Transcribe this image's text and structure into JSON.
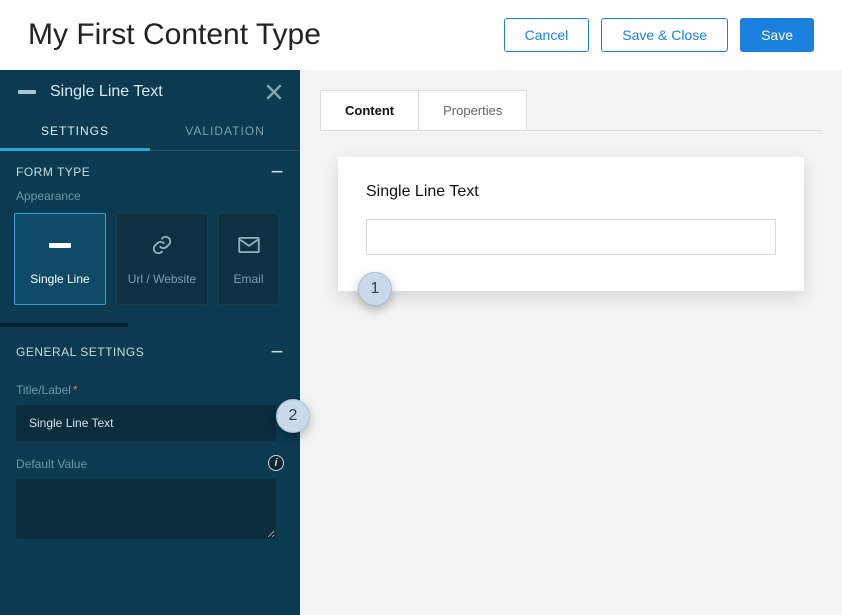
{
  "header": {
    "title": "My First Content Type",
    "cancel": "Cancel",
    "save_close": "Save & Close",
    "save": "Save"
  },
  "sidebar": {
    "field_name": "Single Line Text",
    "tabs": {
      "settings": "SETTINGS",
      "validation": "VALIDATION"
    },
    "form_type": {
      "heading": "FORM TYPE",
      "appearance_label": "Appearance",
      "tiles": {
        "single_line": "Single Line",
        "url": "Url / Website",
        "email": "Email"
      }
    },
    "general": {
      "heading": "GENERAL SETTINGS",
      "title_label": "Title/Label",
      "title_value": "Single Line Text",
      "default_label": "Default Value",
      "default_value": ""
    }
  },
  "main": {
    "tabs": {
      "content": "Content",
      "properties": "Properties"
    },
    "preview": {
      "title": "Single Line Text",
      "value": ""
    }
  },
  "annotations": {
    "one": "1",
    "two": "2"
  }
}
